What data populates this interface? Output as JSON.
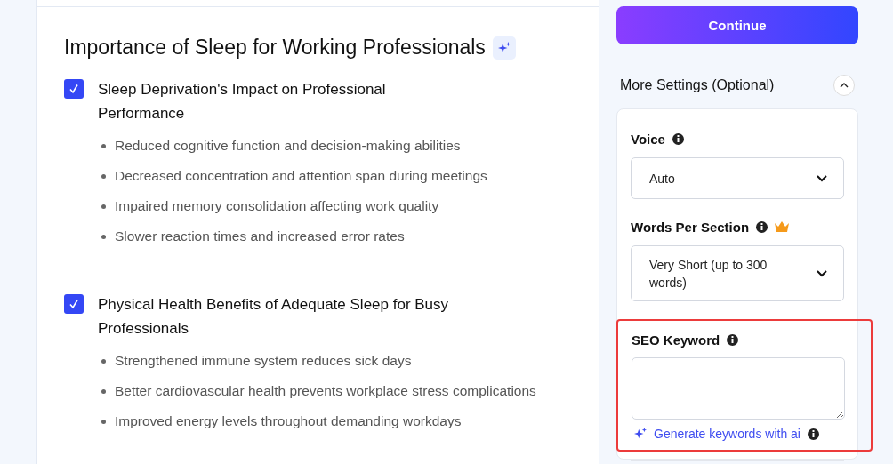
{
  "article": {
    "title": "Importance of Sleep for Working Professionals",
    "sections": [
      {
        "heading": "Sleep Deprivation's Impact on Professional Performance",
        "checked": true,
        "points": [
          "Reduced cognitive function and decision-making abilities",
          "Decreased concentration and attention span during meetings",
          "Impaired memory consolidation affecting work quality",
          "Slower reaction times and increased error rates"
        ]
      },
      {
        "heading": "Physical Health Benefits of Adequate Sleep for Busy Professionals",
        "checked": true,
        "points": [
          "Strengthened immune system reduces sick days",
          "Better cardiovascular health prevents workplace stress complications",
          "Improved energy levels throughout demanding workdays"
        ]
      }
    ]
  },
  "continue_button": "Continue",
  "more_settings": {
    "title": "More Settings (Optional)",
    "expanded": true,
    "voice": {
      "label": "Voice",
      "value": "Auto"
    },
    "words_per_section": {
      "label": "Words Per Section",
      "premium": true,
      "value": "Very Short (up to 300 words)"
    },
    "seo_keyword": {
      "label": "SEO Keyword",
      "highlighted": true,
      "generate_link": "Generate keywords with ai"
    }
  }
}
